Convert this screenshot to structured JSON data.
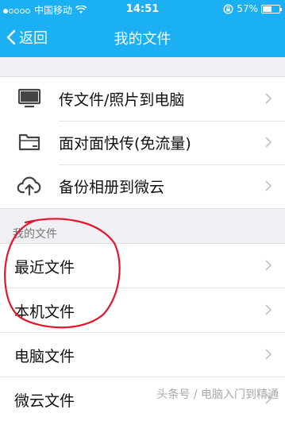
{
  "status_bar": {
    "carrier": "中国移动",
    "time": "14:51",
    "battery_percent": "57%",
    "battery_level": 0.57,
    "signal_bars_filled": 1
  },
  "nav": {
    "back_label": "返回",
    "title": "我的文件"
  },
  "actions": [
    {
      "label": "传文件/照片到电脑",
      "icon": "monitor-icon"
    },
    {
      "label": "面对面快传(免流量)",
      "icon": "folder-icon"
    },
    {
      "label": "备份相册到微云",
      "icon": "cloud-upload-icon"
    }
  ],
  "section": {
    "header": "我的文件",
    "items": [
      {
        "label": "最近文件"
      },
      {
        "label": "本机文件"
      },
      {
        "label": "电脑文件"
      },
      {
        "label": "微云文件"
      }
    ]
  },
  "watermark": "头条号 / 电脑入门到精通",
  "colors": {
    "accent": "#1ab0f3",
    "annotation_red": "#e4142b",
    "background": "#efeff4"
  }
}
